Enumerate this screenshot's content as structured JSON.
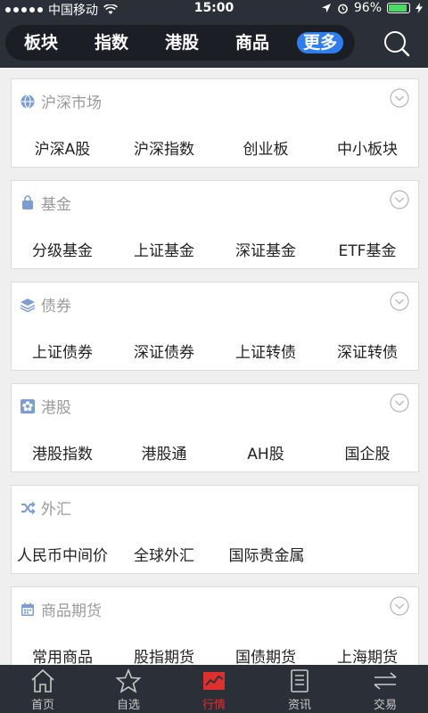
{
  "status_bar": {
    "carrier": "中国移动",
    "time": "15:00",
    "battery": "96%",
    "battery_level": 0.96
  },
  "top_tabs": [
    {
      "label": "板块"
    },
    {
      "label": "指数"
    },
    {
      "label": "港股"
    },
    {
      "label": "商品"
    },
    {
      "label": "更多",
      "active": true
    }
  ],
  "sections": [
    {
      "title": "沪深市场",
      "icon": "globe-icon",
      "items": [
        "沪深A股",
        "沪深指数",
        "创业板",
        "中小板块"
      ],
      "collapsible": true
    },
    {
      "title": "基金",
      "icon": "fund-bag-icon",
      "items": [
        "分级基金",
        "上证基金",
        "深证基金",
        "ETF基金"
      ],
      "collapsible": true
    },
    {
      "title": "债券",
      "icon": "layers-icon",
      "items": [
        "上证债券",
        "深证债券",
        "上证转债",
        "深证转债"
      ],
      "collapsible": true
    },
    {
      "title": "港股",
      "icon": "hk-flower-icon",
      "items": [
        "港股指数",
        "港股通",
        "AH股",
        "国企股"
      ],
      "collapsible": true
    },
    {
      "title": "外汇",
      "icon": "exchange-icon",
      "items": [
        "人民币中间价",
        "全球外汇",
        "国际贵金属"
      ],
      "collapsible": false
    },
    {
      "title": "商品期货",
      "icon": "calendar-icon",
      "items": [
        "常用商品",
        "股指期货",
        "国债期货",
        "上海期货"
      ],
      "collapsible": true
    }
  ],
  "bottom_tabs": [
    {
      "label": "首页",
      "icon": "home-icon"
    },
    {
      "label": "自选",
      "icon": "star-icon"
    },
    {
      "label": "行情",
      "icon": "chart-icon",
      "active": true
    },
    {
      "label": "资讯",
      "icon": "news-icon"
    },
    {
      "label": "交易",
      "icon": "trade-icon"
    }
  ],
  "colors": {
    "nav_bg": "#2b2f37",
    "accent_blue": "#2e7ef0",
    "active_red": "#e0302e"
  }
}
